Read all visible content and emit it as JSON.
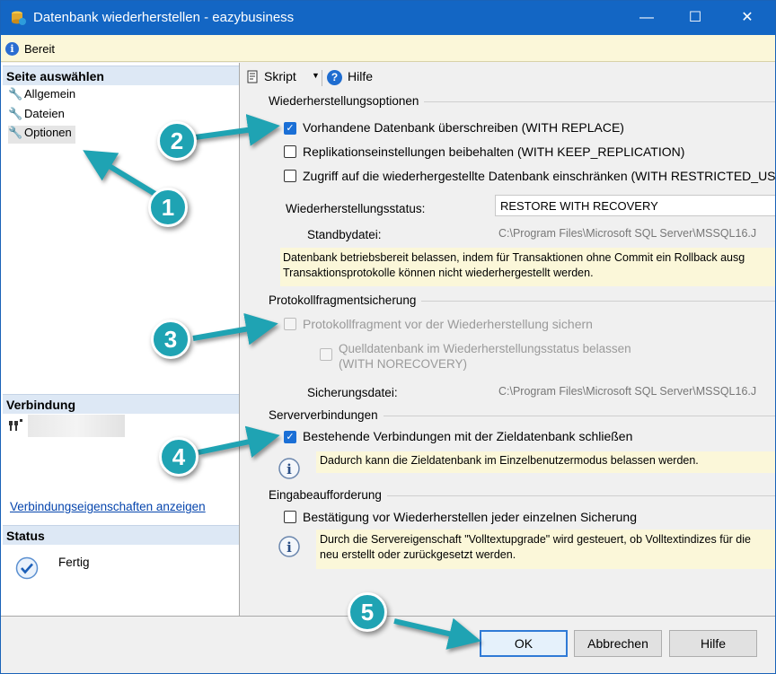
{
  "window": {
    "title": "Datenbank wiederherstellen - eazybusiness",
    "controls": {
      "minimize": "—",
      "maximize": "☐",
      "close": "✕"
    }
  },
  "status_top": "Bereit",
  "left": {
    "select_page_header": "Seite auswählen",
    "pages": [
      {
        "label": "Allgemein",
        "selected": false
      },
      {
        "label": "Dateien",
        "selected": false
      },
      {
        "label": "Optionen",
        "selected": true
      }
    ],
    "connection_header": "Verbindung",
    "connection_link": "Verbindungseigenschaften anzeigen",
    "status_header": "Status",
    "status_value": "Fertig"
  },
  "toolbar": {
    "script_label": "Skript",
    "help_label": "Hilfe"
  },
  "restore_options": {
    "header": "Wiederherstellungsoptionen",
    "with_replace": {
      "label": "Vorhandene Datenbank überschreiben (WITH REPLACE)",
      "checked": true
    },
    "keep_replication": {
      "label": "Replikationseinstellungen beibehalten (WITH KEEP_REPLICATION)",
      "checked": false
    },
    "restricted_user": {
      "label": "Zugriff auf die wiederhergestellte Datenbank einschränken (WITH RESTRICTED_US",
      "checked": false
    },
    "state_label": "Wiederherstellungsstatus:",
    "state_value": "RESTORE WITH RECOVERY",
    "standby_label": "Standbydatei:",
    "standby_value": "C:\\Program Files\\Microsoft SQL Server\\MSSQL16.J",
    "hint_line1": "Datenbank betriebsbereit belassen, indem für Transaktionen ohne Commit ein Rollback ausg",
    "hint_line2": "Transaktionsprotokolle können nicht wiederhergestellt werden."
  },
  "tail_log": {
    "header": "Protokollfragmentsicherung",
    "backup_tail": {
      "label": "Protokollfragment vor der Wiederherstellung sichern",
      "checked": false,
      "enabled": false
    },
    "norecovery_line1": "Quelldatenbank im Wiederherstellungsstatus belassen",
    "norecovery_line2": "(WITH NORECOVERY)",
    "backup_file_label": "Sicherungsdatei:",
    "backup_file_value": "C:\\Program Files\\Microsoft SQL Server\\MSSQL16.J"
  },
  "server_connections": {
    "header": "Serververbindungen",
    "close_existing": {
      "label": "Bestehende Verbindungen mit der Zieldatenbank schließen",
      "checked": true
    },
    "info": "Dadurch kann die Zieldatenbank im Einzelbenutzermodus belassen werden."
  },
  "prompt": {
    "header": "Eingabeaufforderung",
    "confirm_each": {
      "label": "Bestätigung vor Wiederherstellen jeder einzelnen Sicherung",
      "checked": false
    },
    "info_line1": "Durch die Servereigenschaft \"Volltextupgrade\" wird gesteuert, ob Volltextindizes für die",
    "info_line2": "neu erstellt oder zurückgesetzt werden."
  },
  "buttons": {
    "ok": "OK",
    "cancel": "Abbrechen",
    "help": "Hilfe"
  },
  "callouts": [
    "1",
    "2",
    "3",
    "4",
    "5"
  ],
  "colors": {
    "titlebar": "#1366c4",
    "callout": "#1fa3b3",
    "checkbox_checked": "#1a6fd6",
    "info_bg": "#fbf7d9",
    "link": "#0645ad"
  }
}
